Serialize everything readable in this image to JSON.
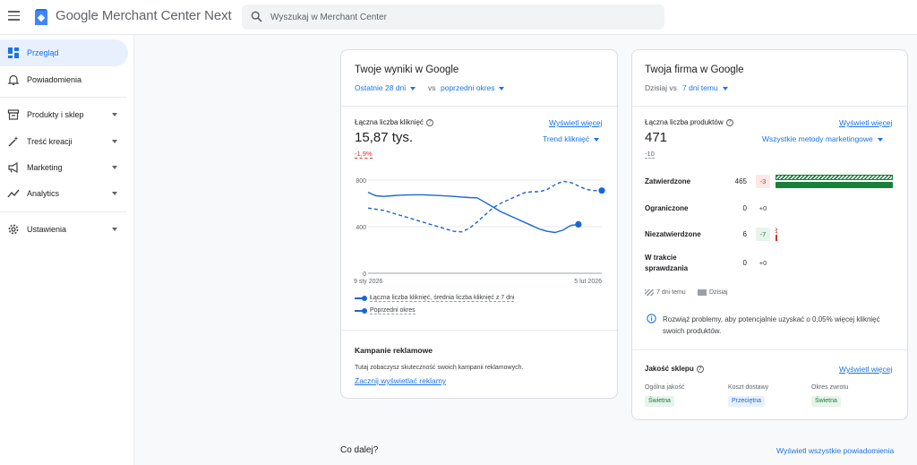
{
  "app": {
    "title": "Google Merchant Center Next"
  },
  "search": {
    "placeholder": "Wyszukaj w Merchant Center"
  },
  "sidebar": {
    "items": [
      {
        "label": "Przegląd",
        "icon": "dashboard-icon"
      },
      {
        "label": "Powiadomienia",
        "icon": "bell-icon"
      },
      {
        "label": "Produkty i sklep",
        "icon": "store-icon"
      },
      {
        "label": "Treść kreacji",
        "icon": "magic-wand-icon"
      },
      {
        "label": "Marketing",
        "icon": "megaphone-icon"
      },
      {
        "label": "Analytics",
        "icon": "trend-icon"
      },
      {
        "label": "Ustawienia",
        "icon": "gear-icon"
      }
    ]
  },
  "results": {
    "title": "Twoje wyniki w Google",
    "period": "Ostatnie 28 dni",
    "vs": "vs",
    "compare": "poprzedni okres",
    "metric_label": "Łączna liczba kliknięć",
    "view_more": "Wyświetl więcej",
    "value": "15,87 tys.",
    "trend_select": "Trend kliknięć",
    "change": "-1,9%",
    "legend_current": "Łączna liczba kliknięć, średnia liczba kliknięć z 7 dni",
    "legend_previous": "Poprzedni okres",
    "campaigns_title": "Kampanie reklamowe",
    "campaigns_text": "Tutaj zobaczysz skuteczność swoich kampanii reklamowych.",
    "campaigns_link": "Zacznij wyświetlać reklamy"
  },
  "chart_data": {
    "type": "line",
    "x_tick_labels": [
      "9 sty 2026",
      "5 lut 2026"
    ],
    "y_tick_labels": [
      "800",
      "400",
      "0"
    ],
    "ylim": [
      0,
      800
    ],
    "series": [
      {
        "name": "Łączna liczba kliknięć, średnia liczba kliknięć z 7 dni",
        "style": "solid",
        "color": "#1967d2",
        "values": [
          695,
          665,
          660,
          665,
          670,
          672,
          674,
          674,
          671,
          668,
          664,
          660,
          655,
          650,
          648,
          610,
          570,
          530,
          500,
          470,
          440,
          410,
          380,
          360,
          350,
          370,
          410,
          420
        ]
      },
      {
        "name": "Poprzedni okres",
        "style": "dashed",
        "color": "#1967d2",
        "values": [
          560,
          550,
          540,
          520,
          500,
          480,
          460,
          440,
          420,
          400,
          380,
          360,
          355,
          385,
          440,
          500,
          560,
          600,
          630,
          660,
          690,
          700,
          700,
          720,
          760,
          790,
          780,
          750,
          720,
          710,
          710
        ]
      }
    ]
  },
  "business": {
    "title": "Twoja firma w Google",
    "today": "Dzisiaj vs",
    "compare": "7 dni temu",
    "metric_label": "Łączna liczba produktów",
    "view_more": "Wyświetl więcej",
    "value": "471",
    "change": "-10",
    "methods_select": "Wszystkie metody marketingowe",
    "rows": [
      {
        "label": "Zatwierdzone",
        "value": "465",
        "change": "-3",
        "bar_fraction": 0.987
      },
      {
        "label": "Ograniczone",
        "value": "0",
        "change": "+0",
        "bar_fraction": 0
      },
      {
        "label": "Niezatwierdzone",
        "value": "6",
        "change": "-7",
        "bar_fraction": 0.013
      },
      {
        "label": "W trakcie sprawdzania",
        "value": "0",
        "change": "+0",
        "bar_fraction": 0
      }
    ],
    "legend_7days": "7 dni temu",
    "legend_today": "Dzisiaj",
    "info_text": "Rozwiąż problemy, aby potencjalnie uzyskać o 0,05% więcej kliknięć swoich produktów.",
    "quality_title": "Jakość sklepu",
    "quality_view_more": "Wyświetl więcej",
    "quality": [
      {
        "label": "Ogólna jakość",
        "status": "Świetna"
      },
      {
        "label": "Koszt dostawy",
        "status": "Przeciętna"
      },
      {
        "label": "Okres zwrotu",
        "status": "Świetna"
      }
    ]
  },
  "next": {
    "title": "Co dalej?",
    "view_all": "Wyświetl wszystkie powiadomienia"
  },
  "colors": {
    "accent": "#1a73e8",
    "green": "#188038",
    "red": "#d93025",
    "active_bg": "#e8f0fe"
  }
}
